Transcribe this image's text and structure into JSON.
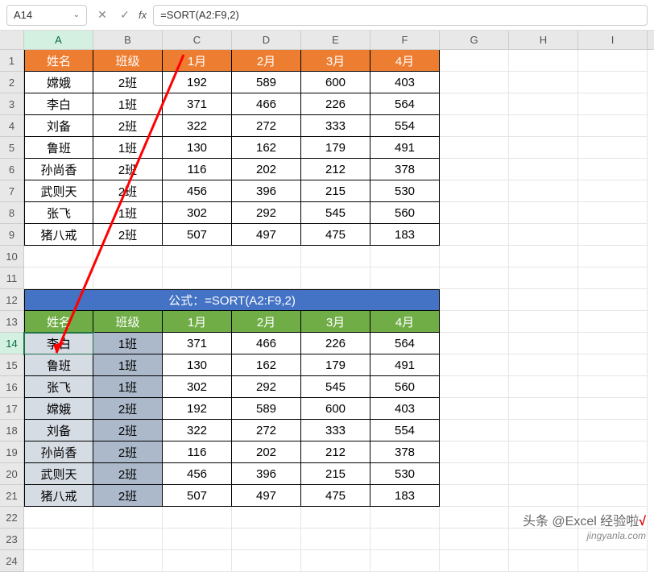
{
  "toolbar": {
    "name_box": "A14",
    "fx_label": "fx",
    "formula": "=SORT(A2:F9,2)"
  },
  "columns": [
    "A",
    "B",
    "C",
    "D",
    "E",
    "F",
    "G",
    "H",
    "I"
  ],
  "rows": [
    "1",
    "2",
    "3",
    "4",
    "5",
    "6",
    "7",
    "8",
    "9",
    "10",
    "11",
    "12",
    "13",
    "14",
    "15",
    "16",
    "17",
    "18",
    "19",
    "20",
    "21",
    "22",
    "23",
    "24"
  ],
  "table1": {
    "headers": [
      "姓名",
      "班级",
      "1月",
      "2月",
      "3月",
      "4月"
    ],
    "rows": [
      [
        "嫦娥",
        "2班",
        "192",
        "589",
        "600",
        "403"
      ],
      [
        "李白",
        "1班",
        "371",
        "466",
        "226",
        "564"
      ],
      [
        "刘备",
        "2班",
        "322",
        "272",
        "333",
        "554"
      ],
      [
        "鲁班",
        "1班",
        "130",
        "162",
        "179",
        "491"
      ],
      [
        "孙尚香",
        "2班",
        "116",
        "202",
        "212",
        "378"
      ],
      [
        "武则天",
        "2班",
        "456",
        "396",
        "215",
        "530"
      ],
      [
        "张飞",
        "1班",
        "302",
        "292",
        "545",
        "560"
      ],
      [
        "猪八戒",
        "2班",
        "507",
        "497",
        "475",
        "183"
      ]
    ]
  },
  "formula_title": "公式：=SORT(A2:F9,2)",
  "table2": {
    "headers": [
      "姓名",
      "班级",
      "1月",
      "2月",
      "3月",
      "4月"
    ],
    "rows": [
      [
        "李白",
        "1班",
        "371",
        "466",
        "226",
        "564"
      ],
      [
        "鲁班",
        "1班",
        "130",
        "162",
        "179",
        "491"
      ],
      [
        "张飞",
        "1班",
        "302",
        "292",
        "545",
        "560"
      ],
      [
        "嫦娥",
        "2班",
        "192",
        "589",
        "600",
        "403"
      ],
      [
        "刘备",
        "2班",
        "322",
        "272",
        "333",
        "554"
      ],
      [
        "孙尚香",
        "2班",
        "116",
        "202",
        "212",
        "378"
      ],
      [
        "武则天",
        "2班",
        "456",
        "396",
        "215",
        "530"
      ],
      [
        "猪八戒",
        "2班",
        "507",
        "497",
        "475",
        "183"
      ]
    ]
  },
  "watermark1": "头条 @Excel 经验啦",
  "watermark2": "jingyanla.com",
  "icons": {
    "cancel": "✕",
    "confirm": "✓",
    "chev": "⌄"
  }
}
